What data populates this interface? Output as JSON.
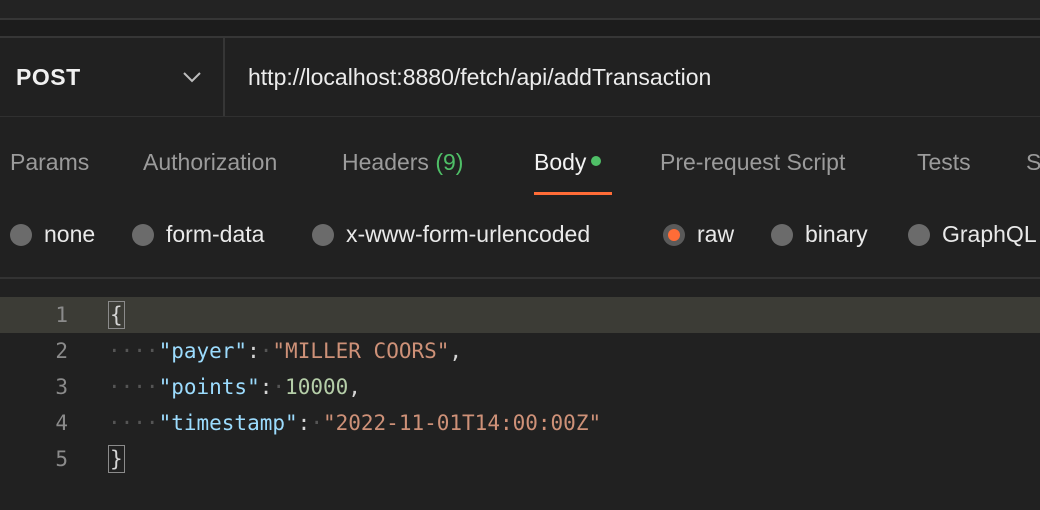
{
  "request": {
    "method": "POST",
    "url": "http://localhost:8880/fetch/api/addTransaction"
  },
  "tabs": {
    "params": "Params",
    "authorization": "Authorization",
    "headers": "Headers",
    "headers_count": "(9)",
    "body": "Body",
    "pre_request": "Pre-request Script",
    "tests": "Tests",
    "settings_partial": "S"
  },
  "body_types": {
    "none": "none",
    "form_data": "form-data",
    "urlencoded": "x-www-form-urlencoded",
    "raw": "raw",
    "binary": "binary",
    "graphql": "GraphQL",
    "selected": "raw"
  },
  "editor": {
    "line_numbers": [
      "1",
      "2",
      "3",
      "4",
      "5"
    ],
    "open_brace": "{",
    "close_brace": "}",
    "fields": [
      {
        "key": "\"payer\"",
        "value": "\"MILLER COORS\"",
        "value_type": "string",
        "trailing": ","
      },
      {
        "key": "\"points\"",
        "value": "10000",
        "value_type": "number",
        "trailing": ","
      },
      {
        "key": "\"timestamp\"",
        "value": "\"2022-11-01T14:00:00Z\"",
        "value_type": "string",
        "trailing": ""
      }
    ]
  },
  "colors": {
    "accent": "#ff6c37",
    "status_green": "#4fbf67",
    "json_key": "#9cdcfe",
    "json_string": "#ce9178",
    "json_number": "#b5cea8"
  },
  "icons": {
    "method_dropdown": "chevron-down-icon"
  }
}
